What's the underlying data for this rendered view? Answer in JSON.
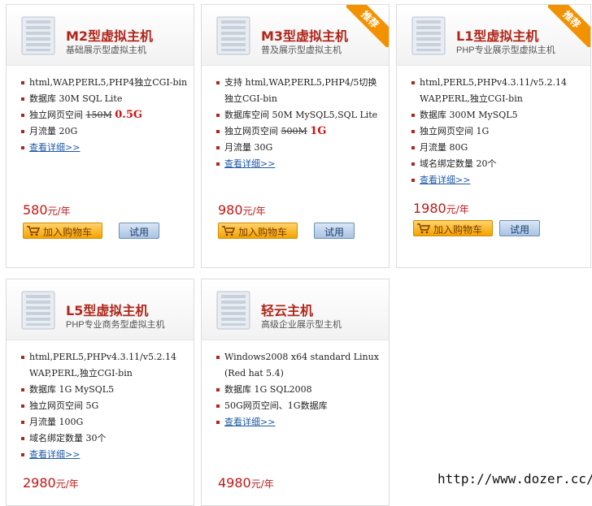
{
  "colors": {
    "title": "#b0261a",
    "price": "#c01818",
    "ribbon": "#f29200",
    "link": "#1f5aa6"
  },
  "plans": [
    {
      "title": "M2型虚拟主机",
      "subtitle": "基础展示型虚拟主机",
      "badge": "",
      "features": [
        {
          "text": "html,WAP,PERL5,PHP4独立CGI-bin"
        },
        {
          "text": "数据库 30M SQL Lite"
        },
        {
          "pre": "独立网页空间 ",
          "old": "150M",
          "new": "0.5G"
        },
        {
          "text": "月流量 20G"
        },
        {
          "link": "查看详细>>"
        }
      ],
      "price": "580",
      "unit": "元/年",
      "cart_label": "加入购物车",
      "try_label": "试用"
    },
    {
      "title": "M3型虚拟主机",
      "subtitle": "普及展示型虚拟主机",
      "badge": "推荐",
      "features": [
        {
          "text": "支持 html,WAP,PERL5,PHP4/5切换 独立CGI-bin"
        },
        {
          "text": "数据库空间 50M MySQL5,SQL Lite"
        },
        {
          "pre": "独立网页空间 ",
          "old": "500M",
          "new": "1G"
        },
        {
          "text": "月流量 30G"
        },
        {
          "link": "查看详细>>"
        }
      ],
      "price": "980",
      "unit": "元/年",
      "cart_label": "加入购物车",
      "try_label": "试用"
    },
    {
      "title": "L1型虚拟主机",
      "subtitle": "PHP专业展示型虚拟主机",
      "badge": "推荐",
      "features": [
        {
          "text": "html,PERL5,PHPv4.3.11/v5.2.14 WAP,PERL,独立CGI-bin"
        },
        {
          "text": "数据库 300M MySQL5"
        },
        {
          "text": "独立网页空间 1G"
        },
        {
          "text": "月流量 80G"
        },
        {
          "text": "域名绑定数量 20个"
        },
        {
          "link": "查看详细>>"
        }
      ],
      "price": "1980",
      "unit": "元/年",
      "cart_label": "加入购物车",
      "try_label": "试用"
    },
    {
      "title": "L5型虚拟主机",
      "subtitle": "PHP专业商务型虚拟主机",
      "badge": "",
      "features": [
        {
          "text": "html,PERL5,PHPv4.3.11/v5.2.14 WAP,PERL,独立CGI-bin"
        },
        {
          "text": "数据库 1G MySQL5"
        },
        {
          "text": "独立网页空间 5G"
        },
        {
          "text": "月流量 100G"
        },
        {
          "text": "域名绑定数量 30个"
        },
        {
          "link": "查看详细>>"
        }
      ],
      "price": "2980",
      "unit": "元/年",
      "cart_label": "",
      "try_label": ""
    },
    {
      "title": "轻云主机",
      "subtitle": "高级企业展示型主机",
      "badge": "",
      "features": [
        {
          "text": "Windows2008 x64 standard Linux (Red hat 5.4)"
        },
        {
          "text": "数据库 1G SQL2008"
        },
        {
          "text": "50G网页空间、1G数据库"
        },
        {
          "link": "查看详细>>"
        }
      ],
      "price": "4980",
      "unit": "元/年",
      "cart_label": "",
      "try_label": ""
    }
  ],
  "watermark": "http://www.dozer.cc/"
}
